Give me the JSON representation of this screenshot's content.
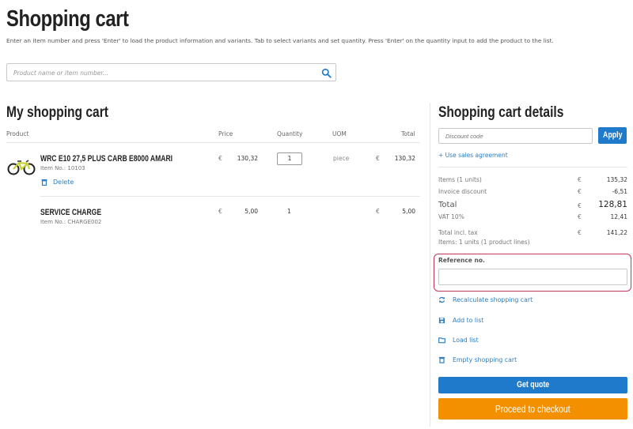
{
  "page": {
    "title": "Shopping cart",
    "instructions": "Enter an item number and press 'Enter' to load the product information and variants. Tab to select variants and set quantity. Press 'Enter' on the quantity input to add the product to the list."
  },
  "search": {
    "placeholder": "Product name or item number..."
  },
  "cart": {
    "title": "My shopping cart",
    "columns": {
      "product": "Product",
      "price": "Price",
      "quantity": "Quantity",
      "uom": "UOM",
      "total": "Total"
    },
    "currency": "€",
    "rows": [
      {
        "name": "WRC E10 27,5 PLUS CARB E8000 AMARI",
        "item_no": "Item No.: 10103",
        "price": "130,32",
        "quantity": "1",
        "uom": "piece",
        "total": "130,32",
        "delete_label": "Delete",
        "image_icon": "mountain-bike-icon"
      },
      {
        "name": "SERVICE CHARGE",
        "item_no": "Item No.: CHARGE002",
        "price": "5,00",
        "quantity": "1",
        "uom": "",
        "total": "5,00"
      }
    ]
  },
  "details": {
    "title": "Shopping cart details",
    "discount_placeholder": "Discount code",
    "apply_label": "Apply",
    "sales_agreement_link": "+ Use sales agreement",
    "currency": "€",
    "summary": [
      {
        "label": "Items (1 units)",
        "value": "135,32"
      },
      {
        "label": "Invoice discount",
        "value": "-6,51"
      },
      {
        "label": "Total",
        "value": "128,81"
      },
      {
        "label": "VAT 10%",
        "value": "12,41"
      },
      {
        "label": "Total incl. tax",
        "value": "141,22"
      }
    ],
    "summary_note": "Items: 1 units (1 product lines)",
    "reference_label": "Reference no.",
    "reference_value": "",
    "actions": [
      {
        "label": "Recalculate shopping cart",
        "icon": "refresh-icon"
      },
      {
        "label": "Add to list",
        "icon": "save-icon"
      },
      {
        "label": "Load list",
        "icon": "folder-icon"
      },
      {
        "label": "Empty shopping cart",
        "icon": "trash-icon"
      }
    ],
    "get_quote_label": "Get quote",
    "checkout_label": "Proceed to checkout"
  },
  "colors": {
    "accent_blue": "#1f7acb",
    "link_blue": "#2a7dc4",
    "checkout_orange": "#f39000",
    "highlight_red": "#c0375a"
  }
}
